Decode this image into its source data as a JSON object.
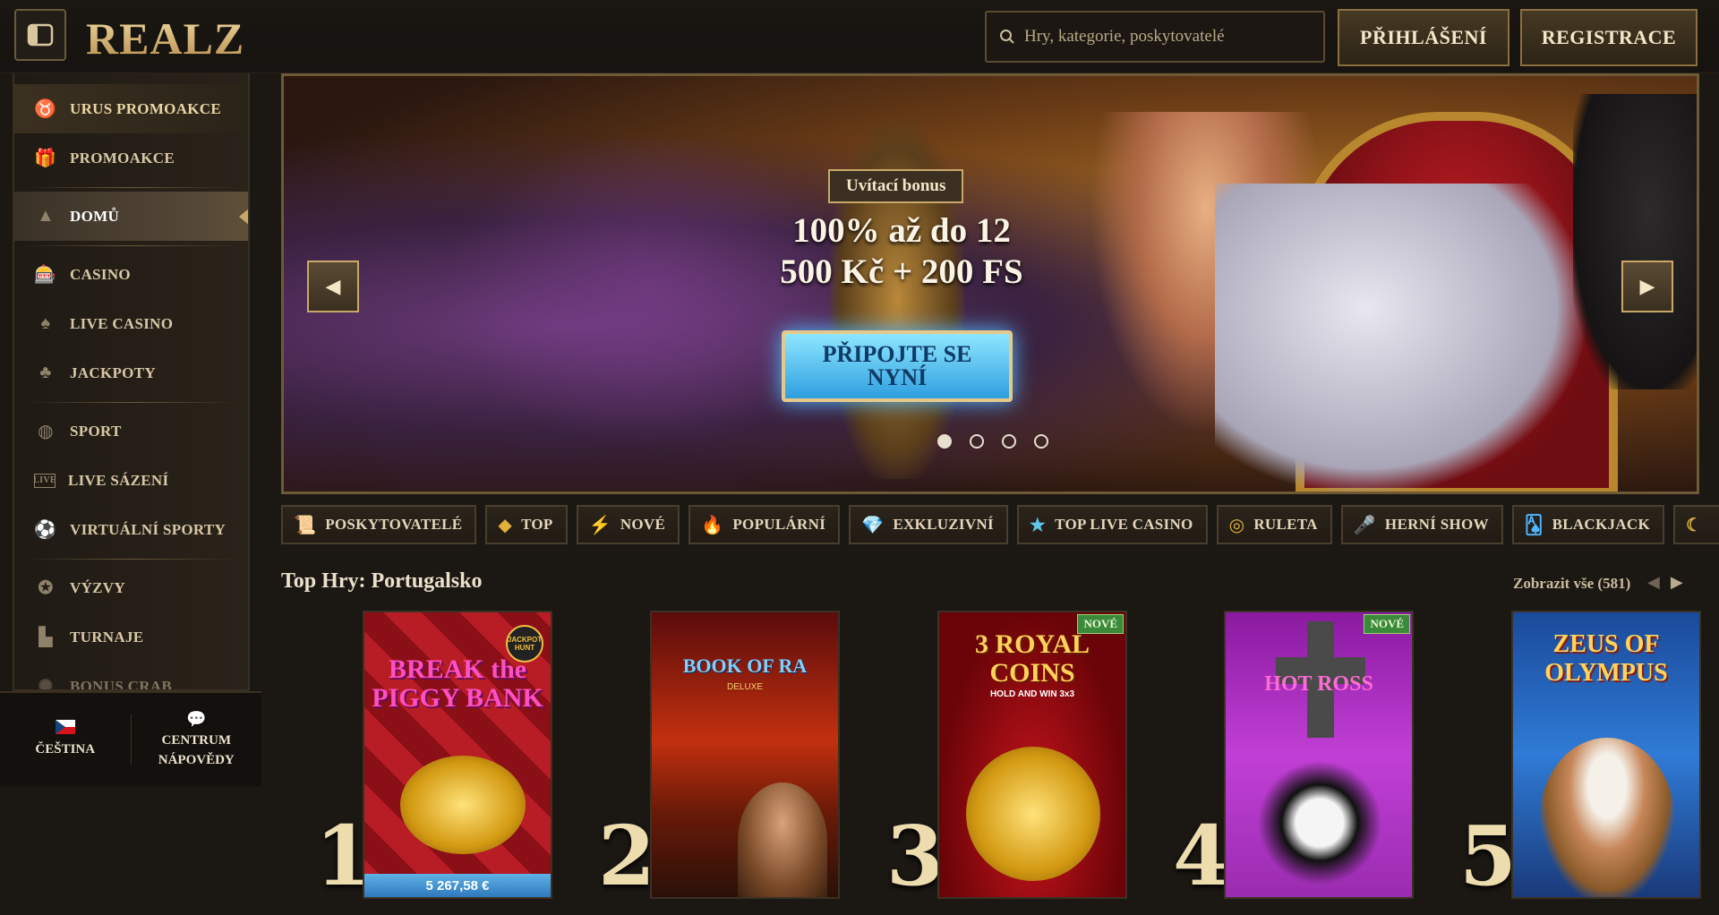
{
  "header": {
    "logo": "REALZ",
    "search_placeholder": "Hry, kategorie, poskytovatelé",
    "login_label": "PŘIHLÁŠENÍ",
    "register_label": "REGISTRACE"
  },
  "sidebar": {
    "items": [
      {
        "label": "URUS PROMOAKCE",
        "icon": "bull-icon"
      },
      {
        "label": "PROMOAKCE",
        "icon": "gift-icon"
      },
      {
        "label": "DOMŮ",
        "icon": "pyramid-icon"
      },
      {
        "label": "CASINO",
        "icon": "slot-machine-icon"
      },
      {
        "label": "LIVE CASINO",
        "icon": "card-icon"
      },
      {
        "label": "JACKPOTY",
        "icon": "clover-icon"
      },
      {
        "label": "SPORT",
        "icon": "basketball-icon"
      },
      {
        "label": "LIVE SÁZENÍ",
        "icon": "live-icon"
      },
      {
        "label": "VIRTUÁLNÍ SPORTY",
        "icon": "football-icon"
      },
      {
        "label": "VÝZVY",
        "icon": "medal-icon"
      },
      {
        "label": "TURNAJE",
        "icon": "podium-icon"
      },
      {
        "label": "BONUS CRAB",
        "icon": "crab-icon"
      }
    ],
    "language_label": "ČEŠTINA",
    "help_label_1": "CENTRUM",
    "help_label_2": "NÁPOVĚDY"
  },
  "hero": {
    "tag": "Uvítací bonus",
    "title_line1": "100% až do 12",
    "title_line2": "500 Kč + 200 FS",
    "cta_line1": "PŘIPOJTE SE",
    "cta_line2": "NYNÍ",
    "slides_count": 4,
    "active_slide": 1
  },
  "categories": [
    {
      "label": "POSKYTOVATELÉ",
      "icon": "scroll-icon"
    },
    {
      "label": "TOP",
      "icon": "gold-bars-icon"
    },
    {
      "label": "NOVÉ",
      "icon": "lightning-icon"
    },
    {
      "label": "POPULÁRNÍ",
      "icon": "flame-icon"
    },
    {
      "label": "EXKLUZIVNÍ",
      "icon": "diamond-icon"
    },
    {
      "label": "TOP LIVE CASINO",
      "icon": "star-icon"
    },
    {
      "label": "RULETA",
      "icon": "roulette-icon"
    },
    {
      "label": "HERNÍ SHOW",
      "icon": "microphone-icon"
    },
    {
      "label": "BLACKJACK",
      "icon": "cards-icon"
    }
  ],
  "section": {
    "title": "Top Hry: Portugalsko",
    "view_all": "Zobrazit vše (581)"
  },
  "games": [
    {
      "rank": "1",
      "title": "BREAK the PIGGY BANK",
      "jackpot": "5 267,58 €",
      "badge": "JACKPOT HUNT"
    },
    {
      "rank": "2",
      "title": "BOOK OF RA",
      "subtitle": "DELUXE"
    },
    {
      "rank": "3",
      "title": "3 ROYAL COINS",
      "subtitle": "HOLD AND WIN 3x3",
      "badge_new": "NOVÉ"
    },
    {
      "rank": "4",
      "title": "HOT ROSS",
      "badge_new": "NOVÉ"
    },
    {
      "rank": "5",
      "title": "ZEUS OF OLYMPUS"
    }
  ]
}
